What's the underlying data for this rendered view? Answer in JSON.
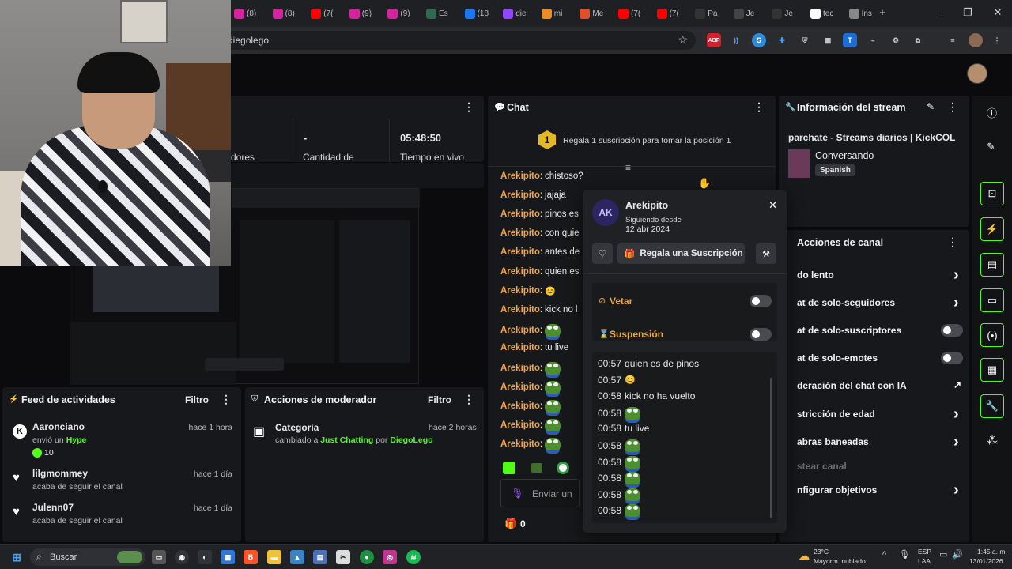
{
  "browser": {
    "tabs": [
      {
        "icon": "instagram-icon",
        "label": "(8)",
        "color": "#d6249f"
      },
      {
        "icon": "instagram-icon",
        "label": "(8)",
        "color": "#d6249f"
      },
      {
        "icon": "youtube-icon",
        "label": "(7(",
        "color": "#ff0000"
      },
      {
        "icon": "instagram-icon",
        "label": "(9)",
        "color": "#d6249f"
      },
      {
        "icon": "instagram-icon",
        "label": "(9)",
        "color": "#d6249f"
      },
      {
        "icon": "a-icon",
        "label": "Es",
        "color": "#2d6a4f"
      },
      {
        "icon": "facebook-icon",
        "label": "(18",
        "color": "#1877f2"
      },
      {
        "icon": "twitch-icon",
        "label": "die",
        "color": "#9146ff"
      },
      {
        "icon": "app-icon",
        "label": "mi",
        "color": "#f08a24"
      },
      {
        "icon": "app-icon",
        "label": "Me",
        "color": "#e44d26"
      },
      {
        "icon": "youtube-icon",
        "label": "(7(",
        "color": "#ff0000"
      },
      {
        "icon": "youtube-icon",
        "label": "(7(",
        "color": "#ff0000"
      },
      {
        "icon": "app-icon",
        "label": "Pa",
        "color": "#333333"
      },
      {
        "icon": "app-icon",
        "label": "Je",
        "color": "#444444"
      },
      {
        "icon": "app-icon",
        "label": "Je",
        "color": "#333333"
      },
      {
        "icon": "google-icon",
        "label": "tec",
        "color": "#ffffff"
      },
      {
        "icon": "globe-icon",
        "label": "Ins",
        "color": "#888888"
      }
    ],
    "new_tab": "+",
    "url": "diegolego",
    "ext_abp": "ABP"
  },
  "stats": {
    "value_1": "-",
    "label_1": "Cantidad de",
    "value_2": "05:48:50",
    "label_2": "Tiempo en vivo",
    "label_0": "dores"
  },
  "chat": {
    "title": "Chat",
    "pin_rank": "1",
    "pin_text": "Regala 1 suscripción para tomar la posición 1",
    "messages": [
      {
        "user": "Arekipito",
        "text": "chistoso?",
        "emote": ""
      },
      {
        "user": "Arekipito",
        "text": "jajaja",
        "emote": ""
      },
      {
        "user": "Arekipito",
        "text": "pinos es",
        "emote": ""
      },
      {
        "user": "Arekipito",
        "text": "con quie",
        "emote": ""
      },
      {
        "user": "Arekipito",
        "text": "antes de",
        "emote": ""
      },
      {
        "user": "Arekipito",
        "text": "quien es",
        "emote": ""
      },
      {
        "user": "Arekipito",
        "text": "",
        "emote": "smile"
      },
      {
        "user": "Arekipito",
        "text": "kick no l",
        "emote": ""
      },
      {
        "user": "Arekipito",
        "text": "",
        "emote": "pepe"
      },
      {
        "user": "Arekipito",
        "text": "tu live",
        "emote": ""
      },
      {
        "user": "Arekipito",
        "text": "",
        "emote": "pepe"
      },
      {
        "user": "Arekipito",
        "text": "",
        "emote": "pepe"
      },
      {
        "user": "Arekipito",
        "text": "",
        "emote": "pepe"
      },
      {
        "user": "Arekipito",
        "text": "",
        "emote": "pepe"
      },
      {
        "user": "Arekipito",
        "text": "",
        "emote": "pepe"
      }
    ],
    "input_placeholder": "Enviar un",
    "gift_count": "0"
  },
  "user_popup": {
    "username": "Arekipito",
    "following_label": "Siguiendo desde",
    "following_date": "12 abr 2024",
    "gift_button": "Regala una Suscripción",
    "ban_label": "Vetar",
    "timeout_label": "Suspensión",
    "log": [
      {
        "time": "00:57",
        "text": "quien es de pinos",
        "emote": ""
      },
      {
        "time": "00:57",
        "text": "",
        "emote": "smile"
      },
      {
        "time": "00:58",
        "text": "kick no ha vuelto",
        "emote": ""
      },
      {
        "time": "00:58",
        "text": "",
        "emote": "pepe"
      },
      {
        "time": "00:58",
        "text": "tu live",
        "emote": ""
      },
      {
        "time": "00:58",
        "text": "",
        "emote": "pepe"
      },
      {
        "time": "00:58",
        "text": "",
        "emote": "pepe"
      },
      {
        "time": "00:58",
        "text": "",
        "emote": "pepe"
      },
      {
        "time": "00:58",
        "text": "",
        "emote": "pepe"
      },
      {
        "time": "00:58",
        "text": "",
        "emote": "pepe"
      }
    ]
  },
  "stream_info": {
    "title": "Información del stream",
    "stream_title": "parchate - Streams diarios | KickCOL",
    "category": "Conversando",
    "language": "Spanish"
  },
  "channel_actions": {
    "title": "Acciones de canal",
    "items": [
      {
        "label": "do lento",
        "control": "chevron"
      },
      {
        "label": "at de solo-seguidores",
        "control": "chevron"
      },
      {
        "label": "at de solo-suscriptores",
        "control": "toggle"
      },
      {
        "label": "at de solo-emotes",
        "control": "toggle"
      },
      {
        "label": "deración del chat con IA",
        "control": "external"
      },
      {
        "label": "stricción de edad",
        "control": "chevron"
      },
      {
        "label": "abras baneadas",
        "control": "chevron"
      },
      {
        "label": "stear canal",
        "control": "none"
      },
      {
        "label": "nfigurar objetivos",
        "control": "chevron"
      }
    ]
  },
  "activity_feed": {
    "title": "Feed de actividades",
    "filter": "Filtro",
    "items": [
      {
        "user": "Aaronciano",
        "line1": "envió un",
        "highlight": "Hype",
        "extra": "10",
        "time": "hace 1 hora",
        "icon": "kick-icon"
      },
      {
        "user": "lilgmommey",
        "line1": "acaba de seguir el canal",
        "highlight": "",
        "extra": "",
        "time": "hace 1 día",
        "icon": "heart-icon"
      },
      {
        "user": "Julenn07",
        "line1": "acaba de seguir el canal",
        "highlight": "",
        "extra": "",
        "time": "hace 1 día",
        "icon": "heart-icon"
      }
    ]
  },
  "mod_actions": {
    "title": "Acciones de moderador",
    "filter": "Filtro",
    "item_title": "Categoría",
    "item_prefix": "cambiado a",
    "item_category": "Just Chatting",
    "item_by": "por",
    "item_user": "DiegoLego",
    "item_time": "hace 2 horas"
  },
  "taskbar": {
    "search_placeholder": "Buscar",
    "weather_temp": "23°C",
    "weather_desc": "Mayorm. nublado",
    "lang1": "ESP",
    "lang2": "LAA",
    "time": "1:45 a. m.",
    "date": "13/01/2026"
  },
  "colors": {
    "kick_green": "#53fc18",
    "username": "#f2a63b",
    "panel": "#17181b"
  }
}
